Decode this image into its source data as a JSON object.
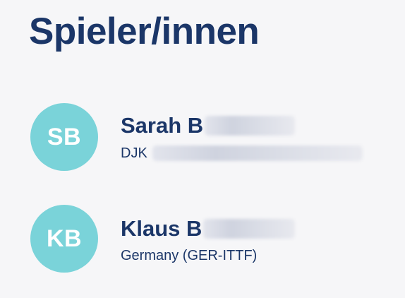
{
  "page": {
    "title": "Spieler/innen"
  },
  "players": [
    {
      "initials": "SB",
      "name_visible": "Sarah B",
      "club_visible": "DJK",
      "club_redacted": true
    },
    {
      "initials": "KB",
      "name_visible": "Klaus B",
      "club_visible": "Germany (GER-ITTF)",
      "club_redacted": false
    }
  ],
  "colors": {
    "background": "#f6f6f8",
    "text": "#1b3668",
    "avatar": "#7ad3d9"
  }
}
